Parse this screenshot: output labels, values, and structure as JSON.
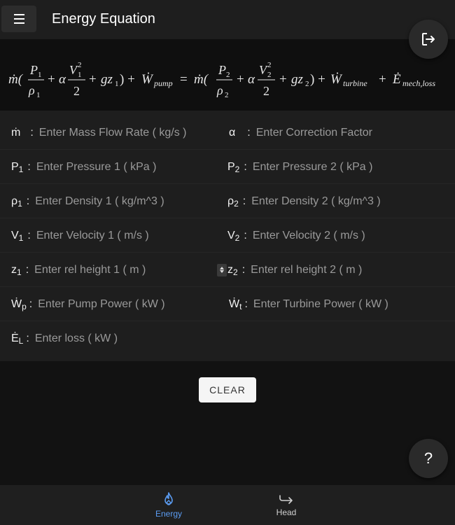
{
  "app": {
    "title": "Energy Equation",
    "menu_icon": "hamburger-menu-icon",
    "logout_icon": "logout-icon"
  },
  "equation": {
    "text": "ṁ(P1/ρ1 + αV1²/2 + gz1) + Ẇpump = ṁ(P2/ρ2 + αV2²/2 + gz2) + Ẇturbine + Ėmech,loss"
  },
  "fields": {
    "mdot": {
      "symbol": "ṁ",
      "sub": "",
      "placeholder": "Enter Mass Flow Rate ( kg/s )"
    },
    "alpha": {
      "symbol": "α",
      "sub": "",
      "placeholder": "Enter Correction Factor"
    },
    "p1": {
      "symbol": "P",
      "sub": "1",
      "placeholder": "Enter Pressure 1 ( kPa )"
    },
    "p2": {
      "symbol": "P",
      "sub": "2",
      "placeholder": "Enter Pressure 2 ( kPa )"
    },
    "rho1": {
      "symbol": "ρ",
      "sub": "1",
      "placeholder": "Enter Density 1 ( kg/m^3 )"
    },
    "rho2": {
      "symbol": "ρ",
      "sub": "2",
      "placeholder": "Enter Density 2 ( kg/m^3 )"
    },
    "v1": {
      "symbol": "V",
      "sub": "1",
      "placeholder": "Enter Velocity 1 ( m/s )"
    },
    "v2": {
      "symbol": "V",
      "sub": "2",
      "placeholder": "Enter Velocity 2 ( m/s )"
    },
    "z1": {
      "symbol": "z",
      "sub": "1",
      "placeholder": "Enter rel height 1 ( m )"
    },
    "z2": {
      "symbol": "z",
      "sub": "2",
      "placeholder": "Enter rel height 2 ( m )"
    },
    "wp": {
      "symbol": "Ẇ",
      "sub": "p",
      "placeholder": "Enter Pump Power ( kW )"
    },
    "wt": {
      "symbol": "Ẇ",
      "sub": "t",
      "placeholder": "Enter Turbine Power ( kW )"
    },
    "el": {
      "symbol": "Ė",
      "sub": "L",
      "placeholder": "Enter loss ( kW )"
    }
  },
  "colon": ":",
  "actions": {
    "clear_label": "CLEAR",
    "help_label": "?"
  },
  "nav": {
    "items": [
      {
        "label": "Energy",
        "icon": "flame-icon",
        "active": true
      },
      {
        "label": "Head",
        "icon": "redo-arrow-icon",
        "active": false
      }
    ]
  },
  "colors": {
    "background": "#121212",
    "surface": "#1e1e1e",
    "accent": "#5b9cf2",
    "text": "#e0e0e0",
    "placeholder": "#9a9a9a"
  }
}
